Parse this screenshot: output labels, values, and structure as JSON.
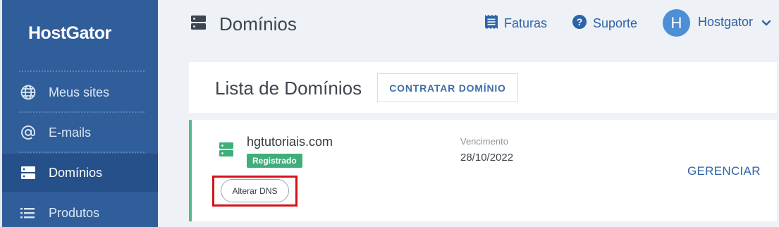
{
  "sidebar": {
    "logo": "HostGator",
    "items": [
      {
        "label": "Meus sites",
        "icon": "globe-icon"
      },
      {
        "label": "E-mails",
        "icon": "at-icon"
      },
      {
        "label": "Domínios",
        "icon": "server-icon",
        "active": true
      },
      {
        "label": "Produtos",
        "icon": "list-icon"
      }
    ]
  },
  "header": {
    "title": "Domínios",
    "title_icon": "server-icon",
    "invoices_label": "Faturas",
    "support_label": "Suporte",
    "user": {
      "initial": "H",
      "name": "Hostgator"
    }
  },
  "list": {
    "title": "Lista de Domínios",
    "contract_button": "CONTRATAR DOMÍNIO"
  },
  "domain": {
    "name": "hgtutoriais.com",
    "status": "Registrado",
    "expiry_label": "Vencimento",
    "expiry_date": "28/10/2022",
    "manage_label": "GERENCIAR",
    "dns_button": "Alterar DNS"
  },
  "colors": {
    "sidebar": "#2f5e9a",
    "sidebar_active": "#26508a",
    "accent": "#2d63a8",
    "status_green": "#3fae7a",
    "highlight_red": "#d4121a"
  }
}
